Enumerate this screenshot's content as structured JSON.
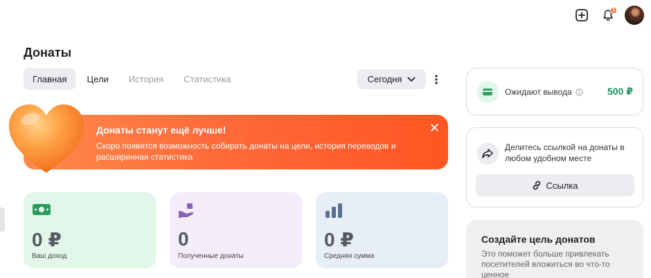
{
  "header": {
    "icons": [
      "plus-square-icon",
      "bell-icon",
      "avatar"
    ],
    "notification_count": "3"
  },
  "page": {
    "title": "Донаты"
  },
  "tabs": [
    {
      "label": "Главная",
      "active": true
    },
    {
      "label": "Цели",
      "active": false
    },
    {
      "label": "История",
      "active": false
    },
    {
      "label": "Статистика",
      "active": false
    }
  ],
  "period": {
    "label": "Сегодня"
  },
  "banner": {
    "title": "Донаты станут ещё лучше!",
    "text": "Скоро появятся возможность собирать донаты на цели, история переводов и расширенная статистика"
  },
  "stats": [
    {
      "icon": "money-icon",
      "value": "0 ₽",
      "label": "Ваш доход",
      "color": "#e2f7ea",
      "icon_color": "#2e9a5a"
    },
    {
      "icon": "hand-heart-icon",
      "value": "0",
      "label": "Полученные донаты",
      "color": "#f3ecfa",
      "icon_color": "#8c5fb8"
    },
    {
      "icon": "bar-chart-icon",
      "value": "0 ₽",
      "label": "Средняя сумма",
      "color": "#e8eef7",
      "icon_color": "#5a6f93"
    }
  ],
  "withdraw": {
    "label": "Ожидают вывода",
    "amount": "500 ₽",
    "accent": "#1f8f5f"
  },
  "share": {
    "text": "Делитесь ссылкой на донаты в любом удобном месте",
    "button": "Ссылка"
  },
  "goal": {
    "title": "Создайте цель донатов",
    "text": "Это поможет больше привлекать посетителей вложиться во что-то ценное"
  },
  "colors": {
    "accent": "#ff5a25",
    "banner_start": "#ff8a4d",
    "banner_end": "#ff5622"
  }
}
